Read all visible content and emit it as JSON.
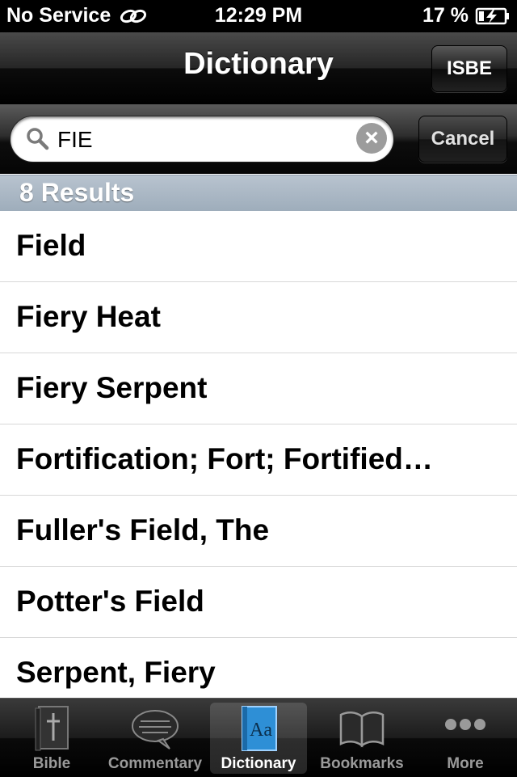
{
  "status_bar": {
    "carrier": "No Service",
    "time": "12:29 PM",
    "battery": "17 %"
  },
  "nav": {
    "title": "Dictionary",
    "isbe_label": "ISBE"
  },
  "search": {
    "query": "FIE",
    "cancel_label": "Cancel"
  },
  "results_header": "8 Results",
  "results": [
    "Field",
    "Fiery Heat",
    "Fiery Serpent",
    "Fortification; Fort; Fortified…",
    "Fuller's Field, The",
    "Potter's Field",
    "Serpent, Fiery"
  ],
  "tabs": [
    {
      "label": "Bible",
      "icon": "bible-icon"
    },
    {
      "label": "Commentary",
      "icon": "speech-bubble-icon"
    },
    {
      "label": "Dictionary",
      "icon": "dictionary-icon",
      "active": true
    },
    {
      "label": "Bookmarks",
      "icon": "open-book-icon"
    },
    {
      "label": "More",
      "icon": "more-dots-icon"
    }
  ]
}
